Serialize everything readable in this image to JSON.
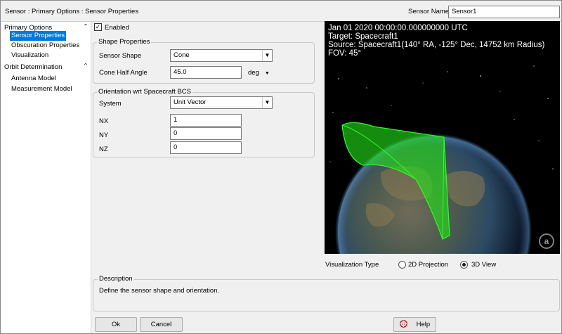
{
  "window": {
    "title": "Sensor : Primary Options : Sensor Properties",
    "sensor_name_label": "Sensor Name",
    "sensor_name_value": "Sensor1"
  },
  "tree": {
    "groups": [
      {
        "label": "Primary Options",
        "items": [
          "Sensor Properties",
          "Obscuration Properties",
          "Visualization"
        ]
      },
      {
        "label": "Orbit Determination",
        "items": [
          "Antenna Model",
          "Measurement Model"
        ]
      }
    ],
    "selected": "Sensor Properties",
    "collapse_icon": "double-chevron-up-icon"
  },
  "enabled": {
    "label": "Enabled",
    "checked": true,
    "check_glyph": "✓"
  },
  "shape": {
    "legend": "Shape Properties",
    "sensor_shape_label": "Sensor Shape",
    "sensor_shape_value": "Cone",
    "half_angle_label": "Cone Half Angle",
    "half_angle_value": "45.0",
    "half_angle_unit": "deg"
  },
  "orientation": {
    "legend": "Orientation wrt Spacecraft BCS",
    "system_label": "System",
    "system_value": "Unit Vector",
    "nx_label": "NX",
    "nx_value": "1",
    "ny_label": "NY",
    "ny_value": "0",
    "nz_label": "NZ",
    "nz_value": "0"
  },
  "view": {
    "line1": "Jan 01 2020 00:00:00.000000000 UTC",
    "line2": "Target: Spacecraft1",
    "line3": "Source: Spacecraft1(140° RA, -125° Dec, 14752 km Radius)",
    "line4": "FOV: 45°",
    "logo_letter": "a",
    "cone_color": "#22e01a"
  },
  "vis_type": {
    "label": "Visualization Type",
    "option_2d": "2D Projection",
    "option_3d": "3D View",
    "selected": "3D View"
  },
  "description": {
    "legend": "Description",
    "text": "Define the sensor shape and orientation."
  },
  "buttons": {
    "ok": "Ok",
    "cancel": "Cancel",
    "help": "Help"
  }
}
